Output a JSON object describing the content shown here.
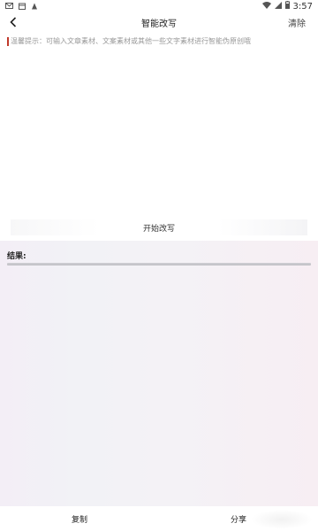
{
  "status_bar": {
    "time": "3:57",
    "left_icons": [
      "mail-icon",
      "calendar-icon",
      "notification-a-icon"
    ],
    "right_icons": [
      "wifi-icon",
      "signal-icon",
      "battery-icon"
    ]
  },
  "header": {
    "title": "智能改写",
    "clear_label": "清除"
  },
  "input": {
    "placeholder": "温馨提示：可输入文章素材、文案素材或其他一些文字素材进行智能伪原创哦"
  },
  "actions": {
    "start_label": "开始改写",
    "copy_label": "复制",
    "share_label": "分享"
  },
  "result": {
    "label": "结果:"
  },
  "colors": {
    "caret": "#c0392b"
  }
}
